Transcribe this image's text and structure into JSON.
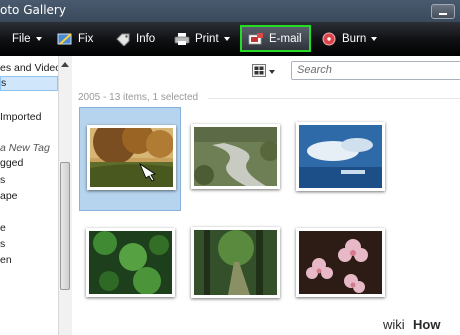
{
  "window": {
    "title": "oto Gallery"
  },
  "toolbar": {
    "file": "File",
    "fix": "Fix",
    "info": "Info",
    "print": "Print",
    "email": "E-mail",
    "burn": "Burn",
    "highlight_color": "#22dd22"
  },
  "sidebar": {
    "items": [
      {
        "label": "es and Video",
        "state": "normal"
      },
      {
        "label": "s",
        "state": "selected"
      },
      {
        "label": "Imported",
        "state": "normal"
      },
      {
        "label": "a New Tag",
        "state": "italic"
      },
      {
        "label": "gged",
        "state": "normal"
      },
      {
        "label": "s",
        "state": "normal"
      },
      {
        "label": "ape",
        "state": "normal"
      },
      {
        "label": "e",
        "state": "normal"
      },
      {
        "label": "s",
        "state": "normal"
      },
      {
        "label": "en",
        "state": "normal"
      }
    ]
  },
  "search": {
    "placeholder": "Search"
  },
  "gallery": {
    "group_header": "2005 - 13 items, 1 selected",
    "photos": [
      {
        "subject": "autumn-tree-landscape",
        "selected": true
      },
      {
        "subject": "river-stream",
        "selected": false
      },
      {
        "subject": "blue-sky-water",
        "selected": false
      },
      {
        "subject": "green-ferns",
        "selected": false
      },
      {
        "subject": "forest-path",
        "selected": false
      },
      {
        "subject": "pink-flowers",
        "selected": false
      }
    ]
  },
  "watermark": {
    "wiki": "wiki",
    "how": "How"
  }
}
